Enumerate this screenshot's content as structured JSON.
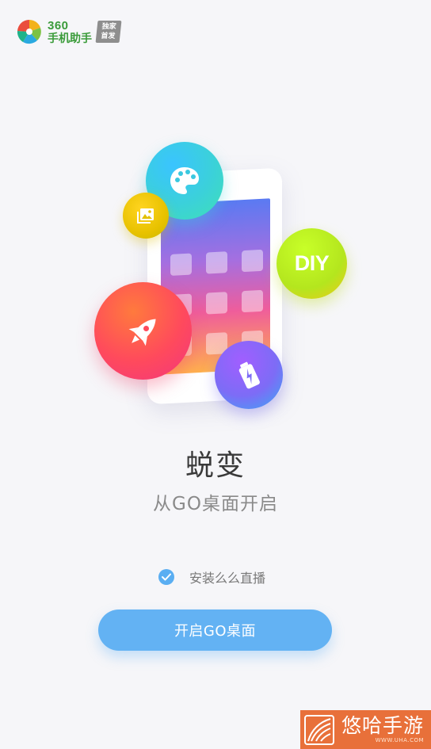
{
  "header": {
    "logo_number": "360",
    "logo_name": "手机助手",
    "badge_line1": "独家",
    "badge_line2": "首发",
    "brand_color": "#3a9b3a"
  },
  "illustration": {
    "icons": [
      "palette-icon",
      "photo-icon",
      "diy-badge",
      "rocket-icon",
      "battery-icon"
    ],
    "diy_text": "DIY",
    "colors": {
      "screen_top": "#5a7af2",
      "screen_bottom": "#ffb14d",
      "palette": "#3bd1d9",
      "photo": "#e8c200",
      "diy": "#b4e61e",
      "rocket": "#ff4a5c",
      "battery": "#7d6cf6"
    }
  },
  "main": {
    "title": "蜕变",
    "subtitle": "从GO桌面开启",
    "checkbox_label": "安装么么直播",
    "checkbox_checked": true,
    "cta_label": "开启GO桌面",
    "accent_color": "#63b2f3"
  },
  "watermark": {
    "text": "悠哈手游",
    "url": "WWW.UHA.COM",
    "color": "#e8703a"
  }
}
